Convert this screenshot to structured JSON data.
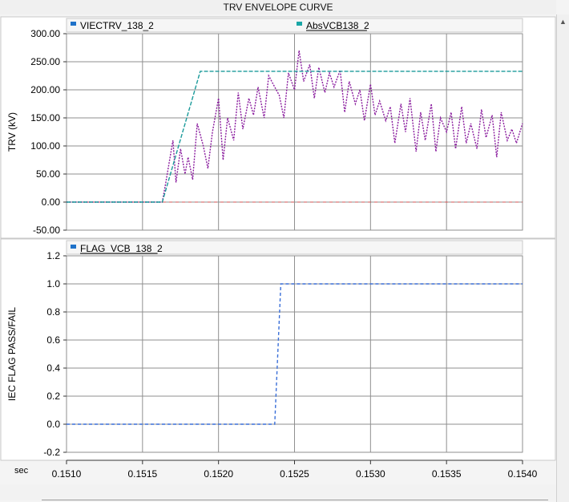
{
  "window": {
    "title": "TRV ENVELOPE CURVE"
  },
  "x_axis": {
    "unit_label": "sec",
    "ticks": [
      "0.1510",
      "0.1515",
      "0.1520",
      "0.1525",
      "0.1530",
      "0.1535",
      "0.1540"
    ],
    "range": [
      0.151,
      0.154
    ]
  },
  "colors": {
    "trv": "#8a1c9e",
    "envelope": "#1a9a9a",
    "flag": "#3a6fd8",
    "zero_line": "#d05050",
    "grid": "#8f8f8f",
    "legend_trv": "#1f72c9",
    "legend_env": "#1aa6a6",
    "legend_flag": "#1f72c9"
  },
  "chart_data": [
    {
      "type": "line",
      "title": "",
      "ylabel": "TRV (kV)",
      "xlabel": "",
      "ylim": [
        -50,
        300
      ],
      "yticks": [
        "300.00",
        "250.00",
        "200.00",
        "150.00",
        "100.00",
        "50.00",
        "0.00",
        "-50.00"
      ],
      "grid": true,
      "legend_placement": "top",
      "series": [
        {
          "name": "VIECTRV_138_2",
          "style": "oscillating",
          "x": [
            0.151,
            0.15163,
            0.15165,
            0.1517,
            0.15172,
            0.15175,
            0.15178,
            0.1518,
            0.15183,
            0.15186,
            0.1519,
            0.15193,
            0.15196,
            0.152,
            0.15203,
            0.15206,
            0.1521,
            0.15213,
            0.15216,
            0.1522,
            0.15223,
            0.15226,
            0.1523,
            0.15233,
            0.15236,
            0.1524,
            0.15243,
            0.15246,
            0.1525,
            0.15253,
            0.15256,
            0.1526,
            0.15263,
            0.15266,
            0.1527,
            0.15273,
            0.15276,
            0.1528,
            0.15283,
            0.15286,
            0.1529,
            0.15293,
            0.15296,
            0.153,
            0.15303,
            0.15306,
            0.1531,
            0.15313,
            0.15316,
            0.1532,
            0.15323,
            0.15326,
            0.1533,
            0.15333,
            0.15336,
            0.1534,
            0.15343,
            0.15346,
            0.1535,
            0.15353,
            0.15356,
            0.1536,
            0.15363,
            0.15366,
            0.1537,
            0.15373,
            0.15376,
            0.1538,
            0.15383,
            0.15386,
            0.1539,
            0.15393,
            0.15396,
            0.154
          ],
          "y": [
            0,
            0,
            30,
            110,
            35,
            95,
            50,
            80,
            40,
            140,
            100,
            60,
            125,
            185,
            75,
            150,
            110,
            195,
            130,
            185,
            155,
            205,
            150,
            225,
            210,
            190,
            150,
            230,
            200,
            270,
            215,
            245,
            185,
            240,
            195,
            230,
            205,
            235,
            160,
            215,
            175,
            200,
            145,
            210,
            155,
            180,
            145,
            170,
            105,
            175,
            125,
            185,
            90,
            160,
            110,
            175,
            90,
            150,
            125,
            160,
            95,
            170,
            105,
            140,
            95,
            165,
            115,
            155,
            80,
            160,
            110,
            130,
            105,
            140
          ]
        },
        {
          "name": "AbsVCB138_2",
          "style": "envelope",
          "x": [
            0.151,
            0.15163,
            0.15163,
            0.15188,
            0.154
          ],
          "y": [
            0,
            0,
            0,
            233,
            233
          ]
        }
      ]
    },
    {
      "type": "line",
      "title": "",
      "ylabel": "IEC FLAG PASS/FAIL",
      "xlabel": "",
      "ylim": [
        -0.2,
        1.2
      ],
      "yticks": [
        "1.2",
        "1.0",
        "0.8",
        "0.6",
        "0.4",
        "0.2",
        "0.0",
        "-0.2"
      ],
      "grid": true,
      "legend_placement": "top",
      "series": [
        {
          "name": "FLAG_VCB_138_2",
          "x": [
            0.151,
            0.15237,
            0.15241,
            0.154
          ],
          "y": [
            0,
            0,
            1,
            1
          ]
        }
      ]
    }
  ]
}
